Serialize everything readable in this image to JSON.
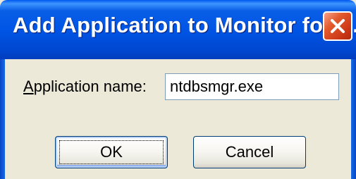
{
  "window": {
    "title": "Add Application to Monitor for E..."
  },
  "form": {
    "label_accel": "A",
    "label_rest": "pplication name:",
    "app_name_value": "ntdbsmgr.exe"
  },
  "buttons": {
    "ok_label": "OK",
    "cancel_label": "Cancel"
  },
  "icons": {
    "close": "close-icon"
  },
  "colors": {
    "titlebar": "#0055e6",
    "close_button": "#e35a2d",
    "dialog_background": "#ece9d8"
  }
}
